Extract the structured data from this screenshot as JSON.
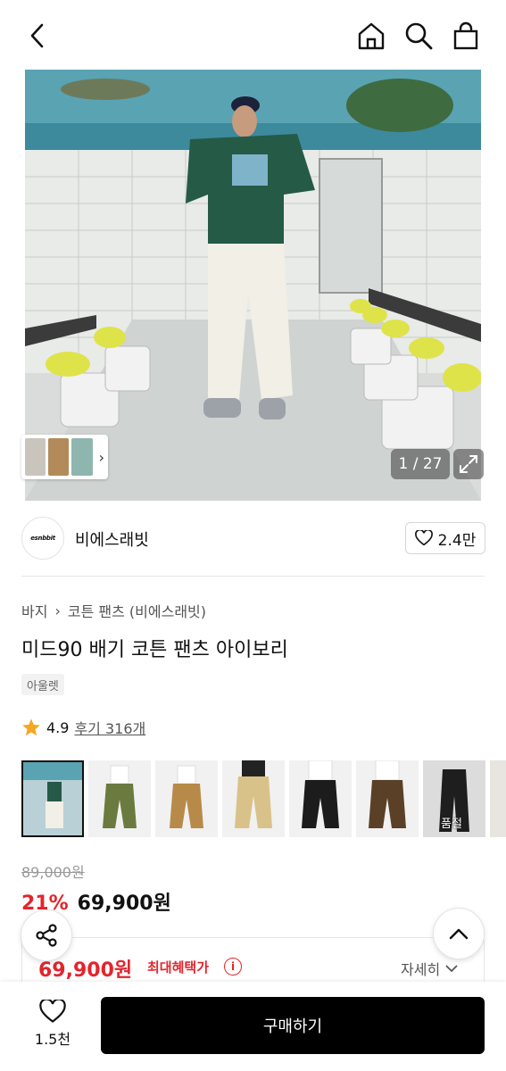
{
  "header": {
    "icons": [
      "chevron-left-icon",
      "home-icon",
      "search-icon",
      "shopping-bag-icon"
    ]
  },
  "hero": {
    "counter": "1 / 27"
  },
  "brand": {
    "logo_text": "esnbbit",
    "name": "비에스래빗",
    "likes": "2.4만"
  },
  "breadcrumb": {
    "items": [
      "바지",
      "코튼 팬츠 (비에스래빗)"
    ]
  },
  "product": {
    "title": "미드90 배기 코튼 팬츠 아이보리",
    "tag": "아울렛",
    "rating": "4.9",
    "reviews": "후기 316개",
    "gallery_label": "품절"
  },
  "price": {
    "original": "89,000원",
    "discount": "21%",
    "sale": "69,900원",
    "max_benefit_price": "69,900원",
    "max_benefit_label": "최대혜택가",
    "details": "자세히"
  },
  "bottom": {
    "wish_count": "1.5천",
    "buy_label": "구매하기"
  },
  "colors": {
    "accent_red": "#e2252d",
    "buy_button": "#000000"
  }
}
